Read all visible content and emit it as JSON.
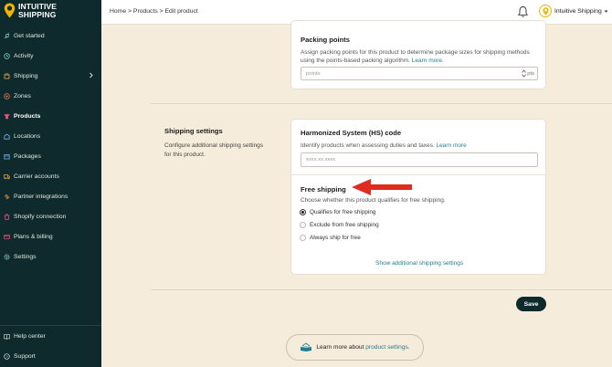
{
  "brand": {
    "line1": "INTUITIVE",
    "line2": "SHIPPING"
  },
  "sidebar": {
    "items": [
      {
        "label": "Get started",
        "icon": "rocket-icon"
      },
      {
        "label": "Activity",
        "icon": "activity-icon"
      },
      {
        "label": "Shipping",
        "icon": "shipping-icon"
      },
      {
        "label": "Zones",
        "icon": "zones-icon"
      },
      {
        "label": "Products",
        "icon": "shirt-icon"
      },
      {
        "label": "Locations",
        "icon": "location-icon"
      },
      {
        "label": "Packages",
        "icon": "package-icon"
      },
      {
        "label": "Carrier accounts",
        "icon": "truck-icon"
      },
      {
        "label": "Partner integrations",
        "icon": "integrations-icon"
      },
      {
        "label": "Shopify connection",
        "icon": "shopify-icon"
      },
      {
        "label": "Plans & billing",
        "icon": "billing-icon"
      },
      {
        "label": "Settings",
        "icon": "gear-icon"
      }
    ],
    "bottom": [
      {
        "label": "Help center",
        "icon": "book-icon"
      },
      {
        "label": "Support",
        "icon": "help-icon"
      }
    ]
  },
  "topbar": {
    "breadcrumb": [
      "Home",
      "Products",
      "Edit product"
    ],
    "separator": ">",
    "account_name": "Intuitive Shipping"
  },
  "packing": {
    "title": "Packing points",
    "desc": "Assign packing points for this product to determine package sizes for shipping methods using the points-based packing algorithm.",
    "learn_more": "Learn more.",
    "placeholder": "points",
    "unit": "pts"
  },
  "shipping_settings": {
    "title": "Shipping settings",
    "desc": "Configure additional shipping settings for this product."
  },
  "hs": {
    "title": "Harmonized System (HS) code",
    "desc": "Identify products when assessing duties and taxes.",
    "learn_more": "Learn more",
    "placeholder": "xxxx.xx.xxxx"
  },
  "free_shipping": {
    "title": "Free shipping",
    "desc": "Choose whether this product qualifies for free shipping.",
    "options": [
      {
        "label": "Qualifies for free shipping",
        "selected": true
      },
      {
        "label": "Exclude from free shipping",
        "selected": false
      },
      {
        "label": "Always ship for free",
        "selected": false
      }
    ],
    "show_more": "Show additional shipping settings"
  },
  "save_label": "Save",
  "learn_more_footer": {
    "prefix": "Learn more about",
    "link": "product settings."
  },
  "colors": {
    "sidebar": "#0f2a2c",
    "accent": "#1e7d91",
    "background": "#f6ecdb",
    "arrow": "#e02b1f",
    "brand_yellow": "#f0b400"
  }
}
